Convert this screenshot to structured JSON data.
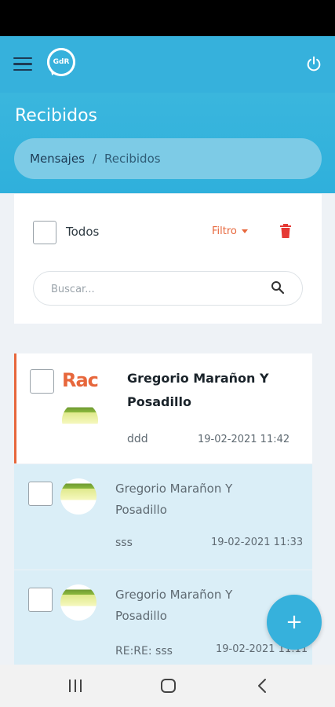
{
  "app": {
    "logo_text": "GdR",
    "page_title": "Recibidos"
  },
  "breadcrumb": {
    "parent": "Mensajes",
    "separator": "/",
    "current": "Recibidos"
  },
  "toolbar": {
    "select_all_label": "Todos",
    "filter_label": "Filtro",
    "search_placeholder": "Buscar..."
  },
  "messages": [
    {
      "sender_line1": "Gregorio Marañon Y",
      "sender_line2": "Posadillo",
      "subject": "ddd",
      "date": "19-02-2021 11:42",
      "unread": true,
      "image_fragment": "Rac"
    },
    {
      "sender_line1": "Gregorio Marañon Y",
      "sender_line2": "Posadillo",
      "subject": "sss",
      "date": "19-02-2021 11:33",
      "unread": false
    },
    {
      "sender_line1": "Gregorio Marañon Y",
      "sender_line2": "Posadillo",
      "subject": "RE:RE: sss",
      "date": "19-02-2021 11:11",
      "unread": false
    }
  ],
  "fab": {
    "label": "+"
  },
  "colors": {
    "primary": "#36b1dc",
    "accent": "#e7673c",
    "delete": "#e53935",
    "read_bg": "#daeef7"
  },
  "icons": [
    "menu-icon",
    "power-icon",
    "trash-icon",
    "search-icon",
    "add-icon",
    "recents-icon",
    "home-icon",
    "back-icon"
  ]
}
